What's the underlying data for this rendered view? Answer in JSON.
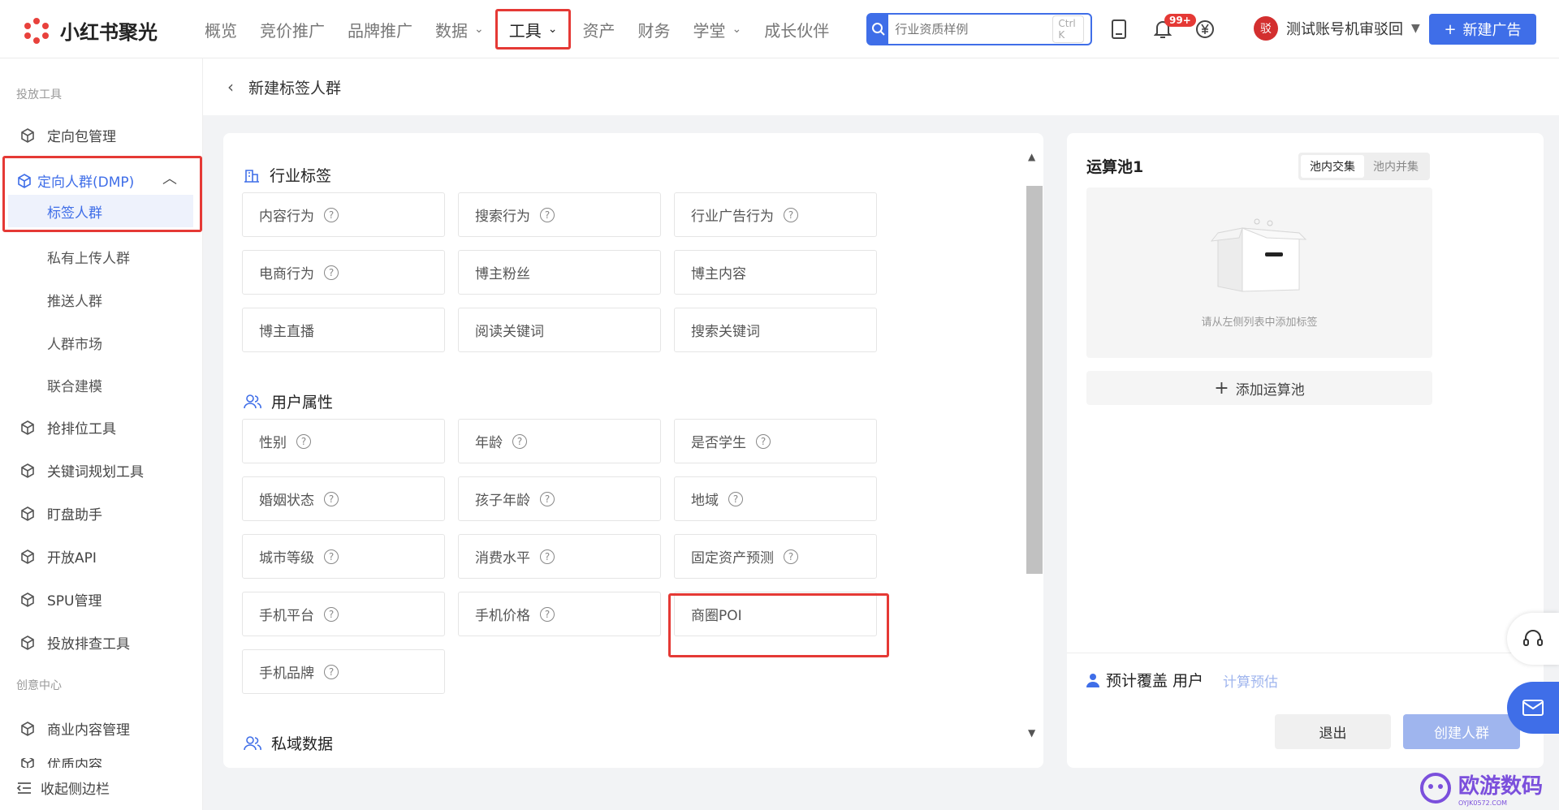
{
  "brand": {
    "name": "小红书聚光"
  },
  "nav": {
    "items": [
      {
        "label": "概览"
      },
      {
        "label": "竞价推广"
      },
      {
        "label": "品牌推广"
      },
      {
        "label": "数据"
      },
      {
        "label": "工具"
      },
      {
        "label": "资产"
      },
      {
        "label": "财务"
      },
      {
        "label": "学堂"
      },
      {
        "label": "成长伙伴"
      }
    ]
  },
  "search": {
    "placeholder": "行业资质样例",
    "shortcut": "Ctrl K"
  },
  "notifications": {
    "badge": "99+"
  },
  "account": {
    "name": "测试账号机审驳回",
    "avatar_text": "驳"
  },
  "new_ad_label": "新建广告",
  "sidebar": {
    "section1": "投放工具",
    "targeting_pkg": "定向包管理",
    "dmp": "定向人群(DMP)",
    "dmp_children": [
      "标签人群",
      "私有上传人群",
      "推送人群",
      "人群市场",
      "联合建模"
    ],
    "tools": [
      "抢排位工具",
      "关键词规划工具",
      "盯盘助手",
      "开放API",
      "SPU管理",
      "投放排查工具"
    ],
    "section2": "创意中心",
    "creative": [
      "商业内容管理",
      "优质内容"
    ],
    "collapse": "收起侧边栏"
  },
  "breadcrumb": {
    "title": "新建标签人群"
  },
  "tag_groups": {
    "industry": {
      "title": "行业标签",
      "items": [
        {
          "label": "内容行为",
          "help": true
        },
        {
          "label": "搜索行为",
          "help": true
        },
        {
          "label": "行业广告行为",
          "help": true
        },
        {
          "label": "电商行为",
          "help": true
        },
        {
          "label": "博主粉丝",
          "help": false
        },
        {
          "label": "博主内容",
          "help": false
        },
        {
          "label": "博主直播",
          "help": false
        },
        {
          "label": "阅读关键词",
          "help": false
        },
        {
          "label": "搜索关键词",
          "help": false
        }
      ]
    },
    "user": {
      "title": "用户属性",
      "items": [
        {
          "label": "性别",
          "help": true
        },
        {
          "label": "年龄",
          "help": true
        },
        {
          "label": "是否学生",
          "help": true
        },
        {
          "label": "婚姻状态",
          "help": true
        },
        {
          "label": "孩子年龄",
          "help": true
        },
        {
          "label": "地域",
          "help": true
        },
        {
          "label": "城市等级",
          "help": true
        },
        {
          "label": "消费水平",
          "help": true
        },
        {
          "label": "固定资产预测",
          "help": true
        },
        {
          "label": "手机平台",
          "help": true
        },
        {
          "label": "手机价格",
          "help": true
        },
        {
          "label": "商圈POI",
          "help": false
        },
        {
          "label": "手机品牌",
          "help": true
        }
      ]
    },
    "private": {
      "title": "私域数据"
    }
  },
  "pool": {
    "title": "运算池1",
    "seg_intersect": "池内交集",
    "seg_union": "池内并集",
    "empty_text": "请从左侧列表中添加标签",
    "add_pool": "添加运算池",
    "cover_label": "预计覆盖 用户",
    "calc_label": "计算预估",
    "exit_label": "退出",
    "create_label": "创建人群"
  },
  "watermark": {
    "text": "欧游数码",
    "sub": "OYJK0572.COM"
  }
}
